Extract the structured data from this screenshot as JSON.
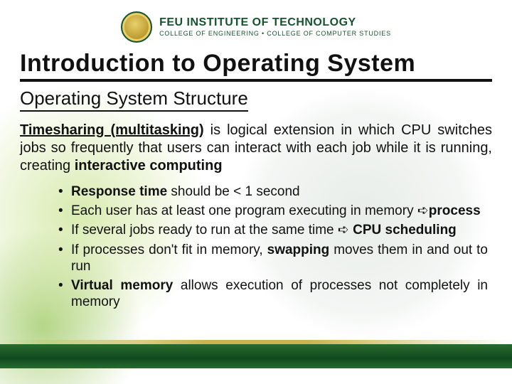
{
  "header": {
    "institution": "FEU INSTITUTE OF TECHNOLOGY",
    "subline": "COLLEGE OF ENGINEERING • COLLEGE OF COMPUTER STUDIES"
  },
  "title": "Introduction to Operating System",
  "subtitle": "Operating System Structure",
  "paragraph": {
    "lead": "Timesharing (multitasking)",
    "body": " is logical extension in which CPU switches jobs so frequently that users can interact with each job while it is running, creating ",
    "tail": "interactive computing"
  },
  "bullets": [
    {
      "pre": "",
      "k1": "Response time",
      "post": " should be < 1 second"
    },
    {
      "pre": "Each user has at least one program executing in memory ",
      "arrow": "➪",
      "k1": "process",
      "post": ""
    },
    {
      "pre": "If several jobs ready to run at the same time ",
      "arrow": "➪",
      "k1": " CPU scheduling",
      "post": ""
    },
    {
      "pre": "If processes don't fit in memory, ",
      "k1": "swapping",
      "post": " moves them in and out to run"
    },
    {
      "pre": "",
      "k1": "Virtual memory",
      "post": " allows execution of processes not completely in memory"
    }
  ]
}
